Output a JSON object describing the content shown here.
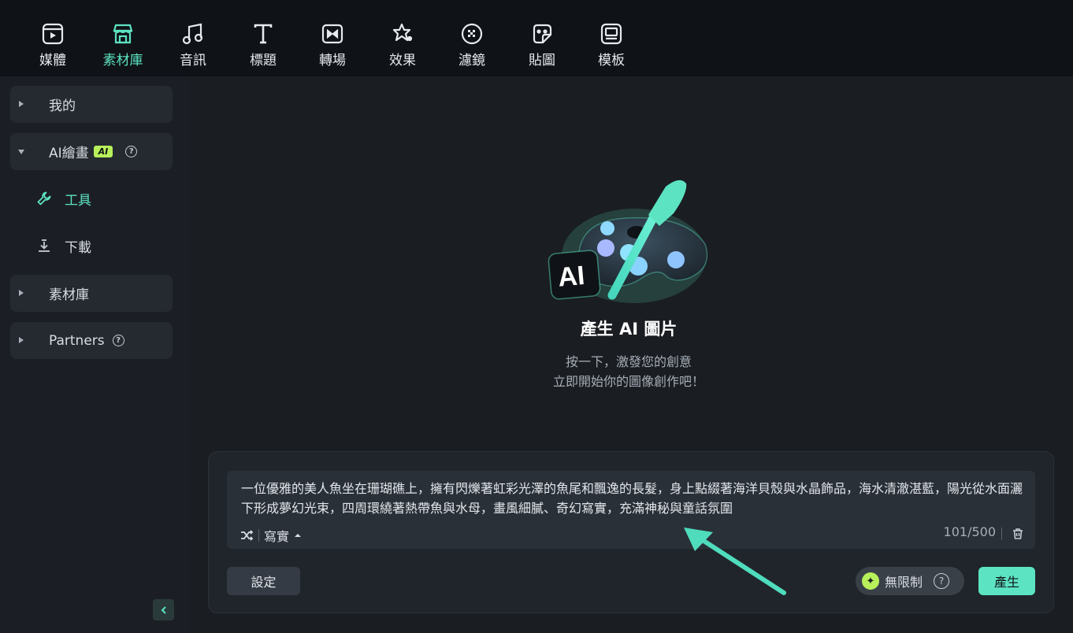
{
  "toolbar": {
    "tabs": [
      {
        "label": "媒體",
        "icon": "media-icon"
      },
      {
        "label": "素材庫",
        "icon": "store-icon",
        "active": true
      },
      {
        "label": "音訊",
        "icon": "music-icon"
      },
      {
        "label": "標題",
        "icon": "title-icon"
      },
      {
        "label": "轉場",
        "icon": "transition-icon"
      },
      {
        "label": "效果",
        "icon": "effects-icon"
      },
      {
        "label": "濾鏡",
        "icon": "filter-icon"
      },
      {
        "label": "貼圖",
        "icon": "sticker-icon"
      },
      {
        "label": "模板",
        "icon": "template-icon"
      }
    ]
  },
  "sidebar": {
    "mine": "我的",
    "ai_drawing": "AI繪畫",
    "ai_badge": "AI",
    "tools": "工具",
    "download": "下載",
    "library": "素材庫",
    "partners": "Partners"
  },
  "hero": {
    "title": "產生 AI 圖片",
    "line1": "按一下，激發您的創意",
    "line2": "立即開始你的圖像創作吧！"
  },
  "prompt": {
    "text": "一位優雅的美人魚坐在珊瑚礁上，擁有閃爍著虹彩光澤的魚尾和飄逸的長髮，身上點綴著海洋貝殼與水晶飾品，海水清澈湛藍，陽光從水面灑下形成夢幻光束，四周環繞著熱帶魚與水母，畫風細膩、奇幻寫實，充滿神秘與童話氛圍",
    "style": "寫實",
    "counter": "101/500"
  },
  "actions": {
    "settings": "設定",
    "unlimited": "無限制",
    "generate": "產生"
  },
  "colors": {
    "accent": "#5ce3c2",
    "badge": "#b7f05a"
  }
}
